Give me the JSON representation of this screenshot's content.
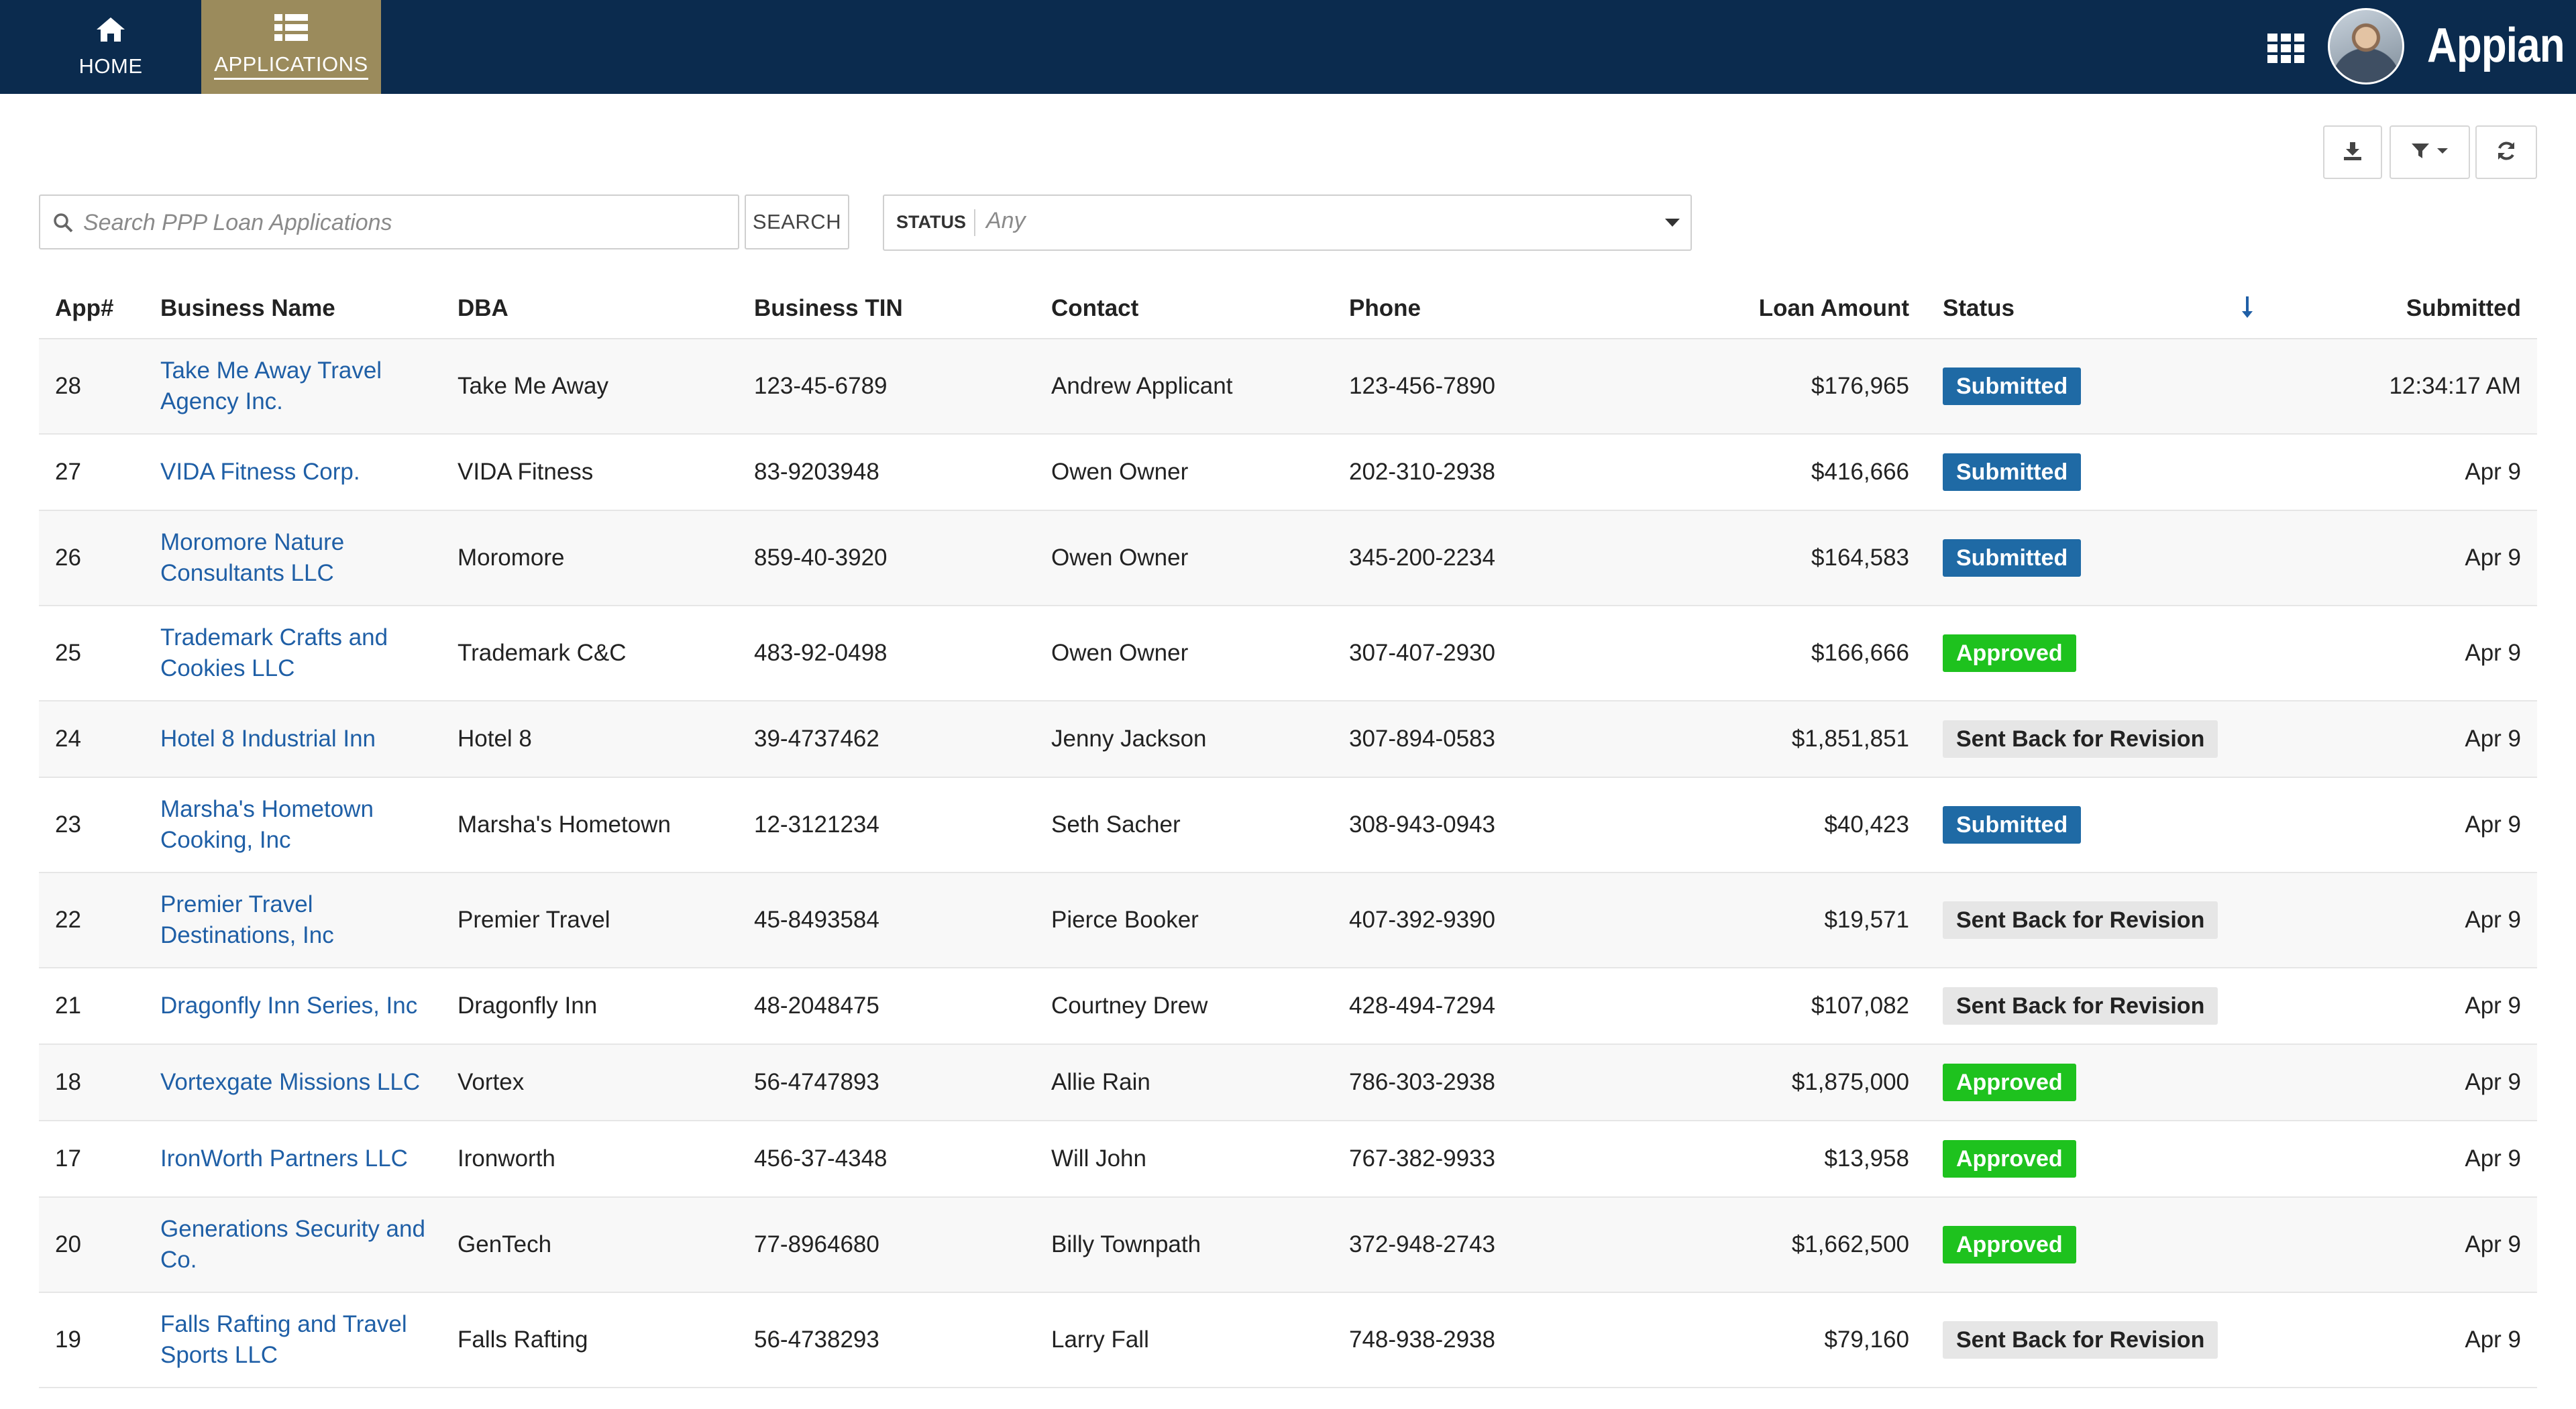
{
  "nav": {
    "home_label": "HOME",
    "applications_label": "APPLICATIONS",
    "brand": "Appian",
    "icons": {
      "home": "home-icon",
      "applications": "list-icon",
      "apps_grid": "grid-icon",
      "avatar": "user-avatar"
    }
  },
  "toolbar": {
    "download_icon": "download-icon",
    "filter_icon": "filter-icon",
    "refresh_icon": "refresh-icon"
  },
  "search": {
    "placeholder": "Search PPP Loan Applications",
    "value": "",
    "button_label": "SEARCH"
  },
  "status_filter": {
    "label": "STATUS",
    "value": "Any"
  },
  "colors": {
    "nav_background": "#0b2b4e",
    "active_tab": "#9b8b5c",
    "link": "#1f5fa6",
    "submitted": "#1f6aa5",
    "approved": "#1ec21e",
    "sent_back": "#e6e6e6"
  },
  "table": {
    "columns": [
      "App#",
      "Business Name",
      "DBA",
      "Business TIN",
      "Contact",
      "Phone",
      "Loan Amount",
      "Status",
      "Submitted"
    ],
    "sort_icon": "sort-descending-icon",
    "rows": [
      {
        "app": "28",
        "business": "Take Me Away Travel Agency Inc.",
        "dba": "Take Me Away",
        "tin": "123-45-6789",
        "contact": "Andrew Applicant",
        "phone": "123-456-7890",
        "amount": "$176,965",
        "status": "Submitted",
        "submitted": "12:34:17 AM"
      },
      {
        "app": "27",
        "business": "VIDA Fitness Corp.",
        "dba": "VIDA Fitness",
        "tin": "83-9203948",
        "contact": "Owen Owner",
        "phone": "202-310-2938",
        "amount": "$416,666",
        "status": "Submitted",
        "submitted": "Apr 9"
      },
      {
        "app": "26",
        "business": "Moromore Nature Consultants LLC",
        "dba": "Moromore",
        "tin": "859-40-3920",
        "contact": "Owen Owner",
        "phone": "345-200-2234",
        "amount": "$164,583",
        "status": "Submitted",
        "submitted": "Apr 9"
      },
      {
        "app": "25",
        "business": "Trademark Crafts and Cookies LLC",
        "dba": "Trademark C&C",
        "tin": "483-92-0498",
        "contact": "Owen Owner",
        "phone": "307-407-2930",
        "amount": "$166,666",
        "status": "Approved",
        "submitted": "Apr 9"
      },
      {
        "app": "24",
        "business": "Hotel 8 Industrial Inn",
        "dba": "Hotel 8",
        "tin": "39-4737462",
        "contact": "Jenny Jackson",
        "phone": "307-894-0583",
        "amount": "$1,851,851",
        "status": "Sent Back for Revision",
        "submitted": "Apr 9"
      },
      {
        "app": "23",
        "business": "Marsha's Hometown Cooking, Inc",
        "dba": "Marsha's Hometown",
        "tin": "12-3121234",
        "contact": "Seth Sacher",
        "phone": "308-943-0943",
        "amount": "$40,423",
        "status": "Submitted",
        "submitted": "Apr 9"
      },
      {
        "app": "22",
        "business": "Premier Travel Destinations, Inc",
        "dba": "Premier Travel",
        "tin": "45-8493584",
        "contact": "Pierce Booker",
        "phone": "407-392-9390",
        "amount": "$19,571",
        "status": "Sent Back for Revision",
        "submitted": "Apr 9"
      },
      {
        "app": "21",
        "business": "Dragonfly Inn Series, Inc",
        "dba": "Dragonfly Inn",
        "tin": "48-2048475",
        "contact": "Courtney Drew",
        "phone": "428-494-7294",
        "amount": "$107,082",
        "status": "Sent Back for Revision",
        "submitted": "Apr 9"
      },
      {
        "app": "18",
        "business": "Vortexgate Missions LLC",
        "dba": "Vortex",
        "tin": "56-4747893",
        "contact": "Allie Rain",
        "phone": "786-303-2938",
        "amount": "$1,875,000",
        "status": "Approved",
        "submitted": "Apr 9"
      },
      {
        "app": "17",
        "business": "IronWorth Partners LLC",
        "dba": "Ironworth",
        "tin": "456-37-4348",
        "contact": "Will John",
        "phone": "767-382-9933",
        "amount": "$13,958",
        "status": "Approved",
        "submitted": "Apr 9"
      },
      {
        "app": "20",
        "business": "Generations Security and Co.",
        "dba": "GenTech",
        "tin": "77-8964680",
        "contact": "Billy Townpath",
        "phone": "372-948-2743",
        "amount": "$1,662,500",
        "status": "Approved",
        "submitted": "Apr 9"
      },
      {
        "app": "19",
        "business": "Falls Rafting and Travel Sports LLC",
        "dba": "Falls Rafting",
        "tin": "56-4738293",
        "contact": "Larry Fall",
        "phone": "748-938-2938",
        "amount": "$79,160",
        "status": "Sent Back for Revision",
        "submitted": "Apr 9"
      }
    ]
  }
}
